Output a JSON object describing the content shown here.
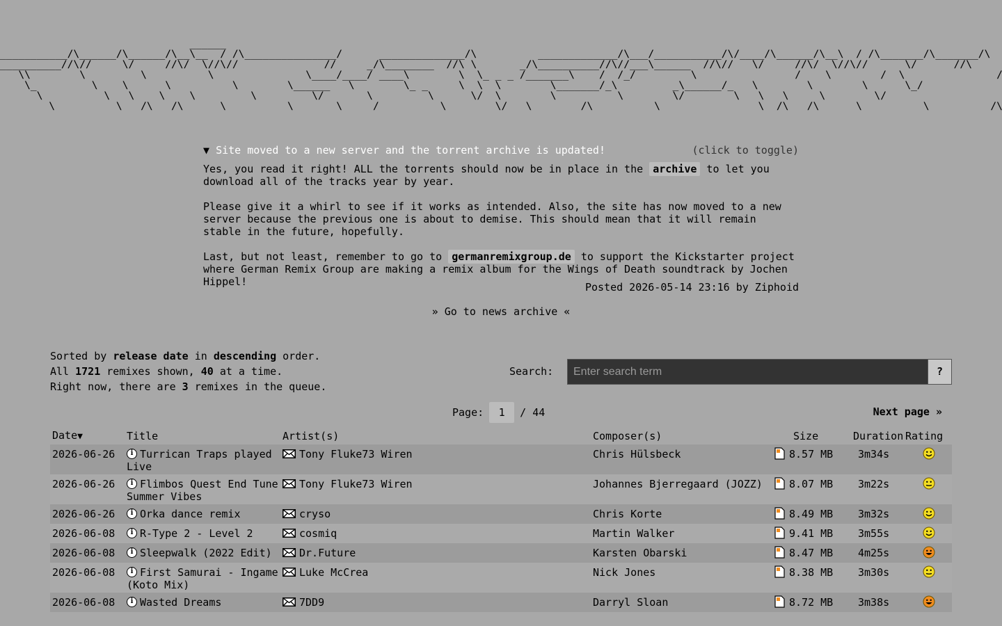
{
  "banner": {
    "ascii_lines": [
      "                               ______                                                                                                                                                             ______",
      "___________/\\______/\\______/\\__\\__  / /\\_______________/      ______________/\\          _____________/\\___/___________/\\/____/\\______/\\__\\  / /\\_______/\\_______/\\",
      "__________//\\//     \\/     //\\/  \\//\\//              //     _/\\________  //\\ \\       _/\\__________//\\//___\\______  //\\//   \\/     //\\/  \\//\\//      \\/      //\\",
      "   \\\\        \\         \\          \\               \\____/____/ ____\\        \\  \\_ _ _ /_______\\    /  /_/         \\                /    \\        /  \\               /   \\/",
      "    \\_         \\    \\      \\          \\        \\______   \\        \\_ _     \\  \\  \\        \\_______/_\\         _\\______/_   \\        \\        \\      \\_/              /_",
      "      \\          \\   \\    \\    \\         \\         \\/       \\         \\      \\/  \\        \\          \\        \\/        \\   \\   \\     \\        \\/                 ",
      "        \\          \\   /\\   /\\      \\          \\       \\_____/          \\        \\/   \\        /\\          \\                \\  /\\   /\\      \\          \\          /\\"
    ]
  },
  "news": {
    "title": "Site moved to a new server and the torrent archive is updated!",
    "toggle_hint": "(click to toggle)",
    "p1_before": "Yes, you read it right! ALL the torrents should now be in place in the ",
    "p1_link": "archive",
    "p1_after": " to let you download all of the tracks year by year.",
    "p2": "Please give it a whirl to see if it works as intended. Also, the site has now moved to a new server because the previous one is about to demise. This should mean that it will remain stable in the future, hopefully.",
    "p3_before": "Last, but not least, remember to go to ",
    "p3_link": "germanremixgroup.de",
    "p3_after": " to support the Kickstarter project where German Remix Group are making a remix album for the Wings of Death soundtrack by Jochen Hippel!",
    "posted": "Posted 2026-05-14 23:16 by Ziphoid"
  },
  "archive_link": "» Go to news archive «",
  "sort": {
    "l1_a": "Sorted by ",
    "sort_field": "release date",
    "l1_b": " in ",
    "sort_order": "descending",
    "l1_c": " order.",
    "l2_a": "All ",
    "total": "1721",
    "l2_b": " remixes shown, ",
    "per_page": "40",
    "l2_c": " at a time.",
    "l3_a": "Right now, there are ",
    "queue": "3",
    "l3_b": " remixes in the queue."
  },
  "search": {
    "label": "Search:",
    "placeholder": "Enter search term",
    "help": "?"
  },
  "pager": {
    "label": "Page:",
    "current": "1",
    "sep": "/ 44",
    "next": "Next page »"
  },
  "table": {
    "headers": {
      "date": "Date",
      "sort_arrow": "▼",
      "title": "Title",
      "artist": "Artist(s)",
      "composer": "Composer(s)",
      "size": "Size",
      "duration": "Duration",
      "rating": "Rating"
    },
    "rows": [
      {
        "date": "2026-06-26",
        "title": "Turrican Traps played Live",
        "artist": "Tony Fluke73 Wiren",
        "composer": "Chris Hülsbeck",
        "size": "8.57 MB",
        "duration": "3m34s",
        "rating": "smile"
      },
      {
        "date": "2026-06-26",
        "title": "Flimbos Quest End Tune Summer Vibes",
        "artist": "Tony Fluke73 Wiren",
        "composer": "Johannes Bjerregaard (JOZZ)",
        "size": "8.07 MB",
        "duration": "3m22s",
        "rating": "neutral"
      },
      {
        "date": "2026-06-26",
        "title": "Orka dance remix",
        "artist": "cryso",
        "composer": "Chris Korte",
        "size": "8.49 MB",
        "duration": "3m32s",
        "rating": "smile"
      },
      {
        "date": "2026-06-08",
        "title": "R-Type 2 - Level 2",
        "artist": "cosmiq",
        "composer": "Martin Walker",
        "size": "9.41 MB",
        "duration": "3m55s",
        "rating": "smile"
      },
      {
        "date": "2026-06-08",
        "title": "Sleepwalk (2022 Edit)",
        "artist": "Dr.Future",
        "composer": "Karsten Obarski",
        "size": "8.47 MB",
        "duration": "4m25s",
        "rating": "grin"
      },
      {
        "date": "2026-06-08",
        "title": "First Samurai - Ingame (Koto Mix)",
        "artist": "Luke McCrea",
        "composer": "Nick Jones",
        "size": "8.38 MB",
        "duration": "3m30s",
        "rating": "neutral"
      },
      {
        "date": "2026-06-08",
        "title": "Wasted Dreams",
        "artist": "7DD9",
        "composer": "Darryl Sloan",
        "size": "8.72 MB",
        "duration": "3m38s",
        "rating": "grin"
      }
    ]
  }
}
